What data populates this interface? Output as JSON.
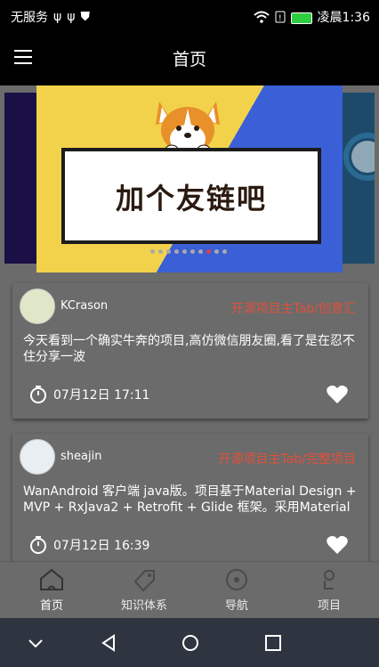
{
  "status_bar": {
    "carrier": "无服务",
    "time": "凌晨1:36",
    "icons": [
      "usb-icon",
      "usb-icon",
      "shield-icon",
      "wifi-icon",
      "sim-icon",
      "battery-icon"
    ]
  },
  "app_bar": {
    "title": "首页",
    "menu_icon": "menu-icon"
  },
  "banner": {
    "text": "加个友链吧",
    "dot_count": 10,
    "active_dot": 8,
    "colors": {
      "yellow": "#f2d24a",
      "blue": "#3a5fd6"
    }
  },
  "articles": [
    {
      "author": "KCrason",
      "chapter": "开源项目主Tab/创意汇",
      "title": "今天看到一个确实牛奔的项目,高仿微信朋友圈,看了是在忍不住分享一波",
      "date": "07月12日 17:11",
      "liked": true
    },
    {
      "author": "sheajin",
      "chapter": "开源项目主Tab/完整项目",
      "title": "WanAndroid 客户端 java版。项目基于Material Design + MVP + RxJava2 + Retrofit + Glide 框架。采用Material",
      "date": "07月12日 16:39",
      "liked": true
    }
  ],
  "bottom_nav": {
    "items": [
      {
        "label": "首页",
        "icon": "home-icon",
        "active": true
      },
      {
        "label": "知识体系",
        "icon": "tag-icon",
        "active": false
      },
      {
        "label": "导航",
        "icon": "compass-icon",
        "active": false
      },
      {
        "label": "项目",
        "icon": "project-icon",
        "active": false
      }
    ]
  },
  "colors": {
    "accent_red": "#e0503a",
    "background": "#6b6b6b",
    "app_bar": "#000000"
  }
}
